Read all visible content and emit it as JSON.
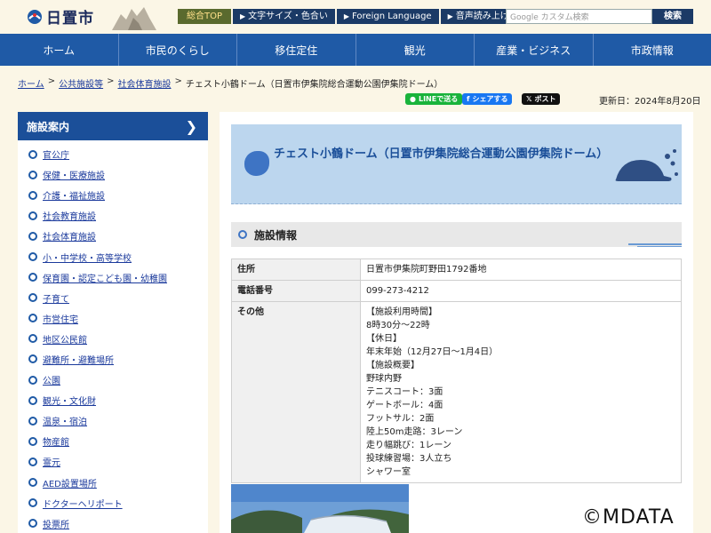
{
  "header": {
    "logo_text": "日置市",
    "top_links": [
      {
        "label": "総合TOP"
      },
      {
        "label": "文字サイズ・色合い"
      },
      {
        "label": "Foreign Language"
      },
      {
        "label": "音声読み上げ"
      }
    ],
    "search": {
      "placeholder": "Google カスタム検索",
      "button": "検索"
    }
  },
  "gnav": [
    "ホーム",
    "市民のくらし",
    "移住定住",
    "観光",
    "産業・ビジネス",
    "市政情報"
  ],
  "breadcrumb": [
    "ホーム",
    "公共施設等",
    "社会体育施設",
    "チェスト小鶴ドーム（日置市伊集院総合運動公園伊集院ドーム）"
  ],
  "share": {
    "line": "LINEで送る",
    "facebook": "シェアする",
    "x": "ポスト"
  },
  "updated": "更新日：2024年8月20日",
  "sidebar": {
    "title": "施設案内",
    "items": [
      "官公庁",
      "保健・医療施設",
      "介護・福祉施設",
      "社会教育施設",
      "社会体育施設",
      "小・中学校・高等学校",
      "保育園・認定こども園・幼稚園",
      "子育て",
      "市営住宅",
      "地区公民館",
      "避難所・避難場所",
      "公園",
      "観光・文化財",
      "温泉・宿泊",
      "物産館",
      "霊元",
      "AED設置場所",
      "ドクターヘリポート",
      "投票所"
    ]
  },
  "main": {
    "title": "チェスト小鶴ドーム（日置市伊集院総合運動公園伊集院ドーム）",
    "section": "施設情報",
    "table": [
      {
        "key": "住所",
        "value": [
          "日置市伊集院町野田1792番地"
        ]
      },
      {
        "key": "電話番号",
        "value": [
          "099-273-4212"
        ]
      },
      {
        "key": "その他",
        "value": [
          "【施設利用時間】",
          "8時30分～22時",
          "【休日】",
          "年末年始（12月27日～1月4日）",
          "【施設概要】",
          "野球内野",
          "テニスコート：3面",
          "ゲートボール：4面",
          "フットサル：2面",
          "陸上50m走路：3レーン",
          "走り幅跳び：1レーン",
          "投球練習場：3人立ち",
          "シャワー室"
        ]
      }
    ]
  },
  "watermark": "©MDATA",
  "colors": {
    "nav": "#1f5aa6",
    "background": "#fbf6e6",
    "title_box": "#bcd6ee"
  }
}
